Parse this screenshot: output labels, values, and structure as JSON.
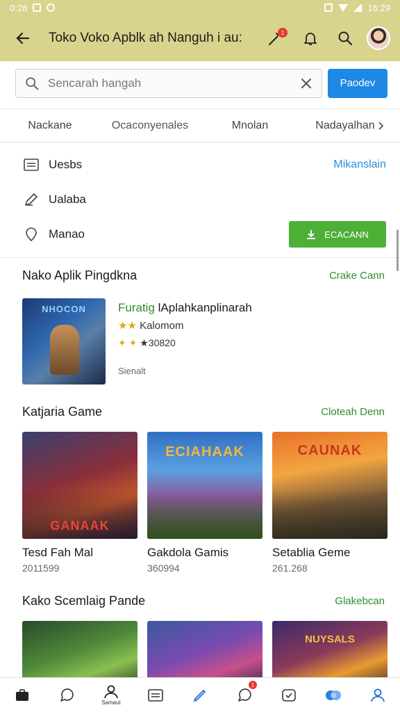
{
  "status_bar": {
    "time_left": "0:28",
    "time_right": "16:29"
  },
  "app_bar": {
    "title": "Toko Voko Apblk ah Nanguh i au:",
    "notif_badge": "1"
  },
  "search": {
    "placeholder": "Sencarah hangah",
    "button_label": "Paodev"
  },
  "tabs": [
    {
      "label": "Nackane"
    },
    {
      "label": "Ocaconyenales"
    },
    {
      "label": "Mnolan"
    },
    {
      "label": "Nadayalhan"
    }
  ],
  "menu": {
    "items": [
      {
        "label": "Uesbs",
        "icon": "list-icon"
      },
      {
        "label": "Ualaba",
        "icon": "pencil-icon"
      },
      {
        "label": "Manao",
        "icon": "location-pin-icon"
      }
    ],
    "link_label": "Mikanslain",
    "action_button_label": "ECACANN"
  },
  "featured": {
    "title": "Nako Aplik Pingdkna",
    "link": "Crake Cann",
    "art_title": "NHOCON",
    "app_name_lead": "Furatig",
    "app_name_rest": " lAplahkanplinarah",
    "rating_stars": "★★",
    "rating_text": "Kalomom",
    "meta_badges": "✦ ✦",
    "meta_count": "★30820",
    "tag": "Sienalt"
  },
  "games": {
    "title": "Katjaria Game",
    "link": "Cloteah Denn",
    "items": [
      {
        "name": "Tesd Fah Mal",
        "meta": "2011599",
        "art_title": "GANAAK"
      },
      {
        "name": "Gakdola Gamis",
        "meta": "360994",
        "art_title": "ECIAHAAK"
      },
      {
        "name": "Setablia Geme",
        "meta": "261.268",
        "art_title": "CAUNAK"
      }
    ]
  },
  "more_section": {
    "title": "Kako Scemlaig Pande",
    "link": "Glakebcan"
  },
  "more_cards": [
    {
      "art_title": ""
    },
    {
      "art_title": ""
    },
    {
      "art_title": "NUYSALS"
    }
  ],
  "bottom_nav": {
    "items": [
      {
        "icon": "briefcase-icon"
      },
      {
        "icon": "chat-bubble-icon"
      },
      {
        "icon": "person-icon",
        "label": "Samaut"
      },
      {
        "icon": "list-card-icon"
      },
      {
        "icon": "edit-icon"
      },
      {
        "icon": "chat-notification-icon",
        "badge": "1"
      },
      {
        "icon": "camera-icon"
      },
      {
        "icon": "cloud-icon"
      },
      {
        "icon": "profile-icon"
      }
    ]
  },
  "colors": {
    "app_bar": "#d8d38d",
    "accent_blue": "#1e88e5",
    "accent_green": "#4caf36",
    "link_green": "#2e8b2e"
  }
}
